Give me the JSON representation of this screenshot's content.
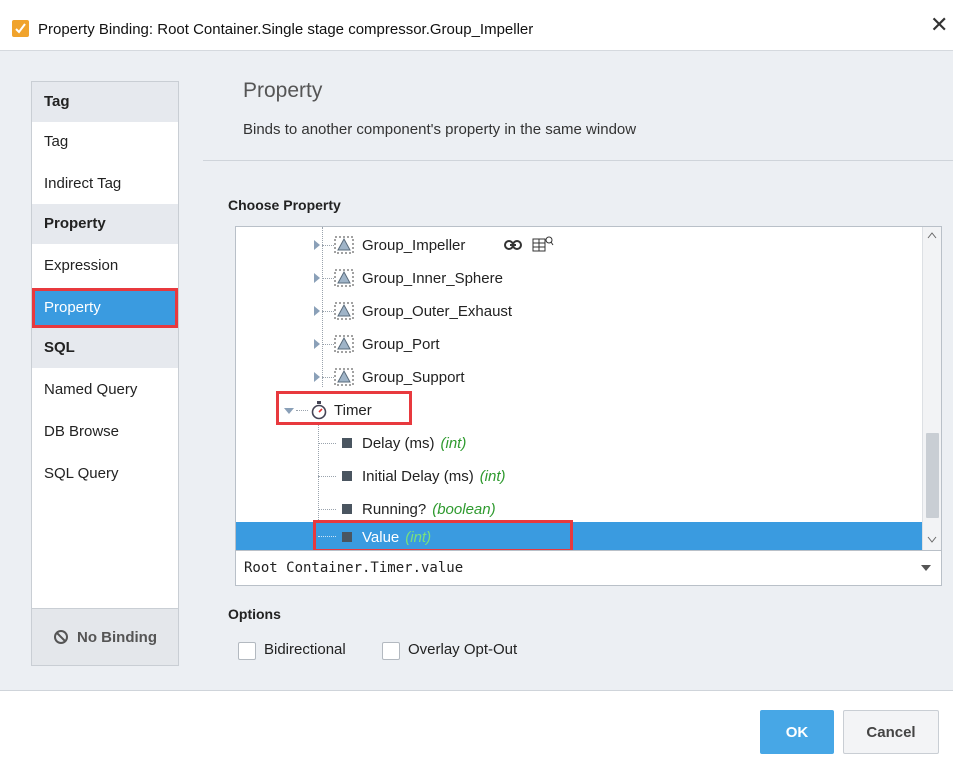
{
  "window": {
    "title": "Property Binding: Root Container.Single stage compressor.Group_Impeller",
    "close_label": "✕"
  },
  "sidebar": {
    "categories": [
      {
        "label": "Tag",
        "items": [
          "Tag",
          "Indirect Tag"
        ]
      },
      {
        "label": "Property",
        "items": [
          "Expression",
          "Property"
        ]
      },
      {
        "label": "SQL",
        "items": [
          "Named Query",
          "DB Browse",
          "SQL Query"
        ]
      }
    ],
    "selected_item": "Property",
    "no_binding_label": "No Binding"
  },
  "header": {
    "title": "Property",
    "subtitle": "Binds to another component's property in the same window"
  },
  "choose_property": {
    "label": "Choose Property",
    "tree": [
      {
        "label": "Group_Impeller",
        "kind": "group",
        "expanded": false,
        "badges": [
          "link-icon",
          "binding-table-icon"
        ]
      },
      {
        "label": "Group_Inner_Sphere",
        "kind": "group",
        "expanded": false
      },
      {
        "label": "Group_Outer_Exhaust",
        "kind": "group",
        "expanded": false
      },
      {
        "label": "Group_Port",
        "kind": "group",
        "expanded": false
      },
      {
        "label": "Group_Support",
        "kind": "group",
        "expanded": false
      },
      {
        "label": "Timer",
        "kind": "timer",
        "expanded": true,
        "highlighted": true
      },
      {
        "label": "Delay (ms)",
        "type": "(int)",
        "kind": "property"
      },
      {
        "label": "Initial Delay (ms)",
        "type": "(int)",
        "kind": "property"
      },
      {
        "label": "Running?",
        "type": "(boolean)",
        "kind": "property"
      },
      {
        "label": "Value",
        "type": "(int)",
        "kind": "property",
        "selected": true,
        "highlighted": true
      }
    ],
    "path_value": "Root Container.Timer.value"
  },
  "options": {
    "label": "Options",
    "checkboxes": [
      {
        "label": "Bidirectional",
        "checked": false
      },
      {
        "label": "Overlay Opt-Out",
        "checked": false
      }
    ]
  },
  "footer": {
    "ok_label": "OK",
    "cancel_label": "Cancel"
  },
  "colors": {
    "selection": "#3a9be0",
    "highlight_box": "#e8393e",
    "type_hint": "#2e9a2e",
    "ok_button": "#47a7e6"
  }
}
